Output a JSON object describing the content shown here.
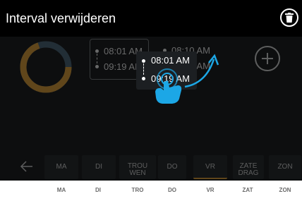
{
  "header": {
    "title": "Interval verwijderen",
    "delete_icon": "trash-icon"
  },
  "colors": {
    "accent": "#c58a2a",
    "header_bg": "#000000",
    "screen_bg": "#0d0e0f",
    "gesture": "#1ca7e6"
  },
  "ring_icon": "progress-ring",
  "interval_cards": [
    {
      "start": "08:01 AM",
      "end": "09:19 AM"
    },
    {
      "start": "08:10 AM",
      "end": "09:19 AM"
    }
  ],
  "popup": {
    "start": "08:01 AM",
    "end": "09:19 AM"
  },
  "gesture_icon": "long-press-hand-icon",
  "days": [
    "MA",
    "DI",
    "TROU WEN",
    "DO",
    "VR",
    "ZATE DRAG",
    "ZON"
  ],
  "active_day": "VR",
  "bottom_days": [
    "MA",
    "DI",
    "TRO",
    "DO",
    "VR",
    "ZAT",
    "ZON"
  ]
}
